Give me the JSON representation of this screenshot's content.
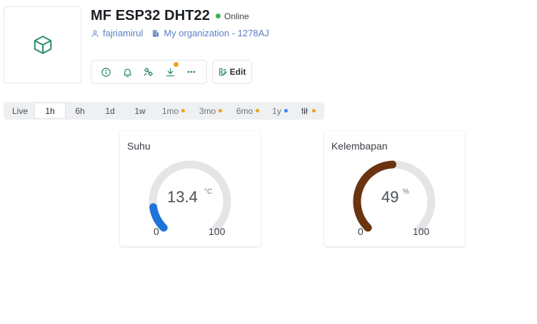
{
  "device": {
    "name": "MF ESP32 DHT22",
    "status": "Online",
    "status_color": "#4caf50",
    "owner": "fajriamirul",
    "organization": "My organization - 1278AJ",
    "thumbnail_icon": "cube-icon"
  },
  "actions": {
    "icons": [
      "info-icon",
      "bell-icon",
      "satellite-icon",
      "download-icon",
      "more-icon"
    ],
    "download_badge_color": "#f0a020",
    "edit_label": "Edit"
  },
  "time_ranges": {
    "items": [
      {
        "label": "Live"
      },
      {
        "label": "1h",
        "active": true
      },
      {
        "label": "6h"
      },
      {
        "label": "1d"
      },
      {
        "label": "1w"
      },
      {
        "label": "1mo",
        "dot": "#f0a020"
      },
      {
        "label": "3mo",
        "dot": "#f0a020"
      },
      {
        "label": "6mo",
        "dot": "#f0a020"
      },
      {
        "label": "1y",
        "dot": "#3b82f6"
      }
    ],
    "custom_icon": "sliders-icon",
    "custom_dot": "#f0a020"
  },
  "widgets": [
    {
      "title": "Suhu",
      "value": "13.4",
      "unit": "°C",
      "min": "0",
      "max": "100",
      "color": "#1e74d8"
    },
    {
      "title": "Kelembapan",
      "value": "49",
      "unit": "%",
      "min": "0",
      "max": "100",
      "color": "#6b3410"
    }
  ]
}
